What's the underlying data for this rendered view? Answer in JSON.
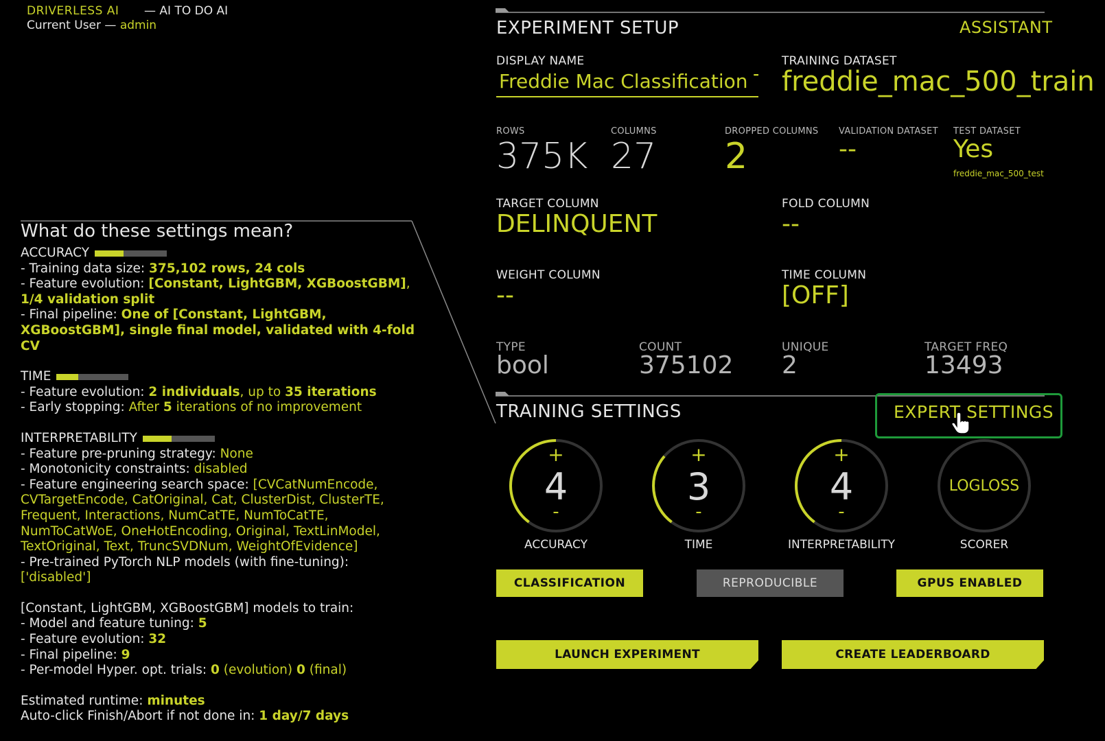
{
  "header": {
    "brand": "DRIVERLESS AI",
    "tagline": "— AI TO DO AI",
    "user_prefix": "Current User — ",
    "user_name": "admin"
  },
  "help": {
    "title": "What do these settings mean?",
    "accuracy": {
      "heading": "ACCURACY",
      "level": 0.4,
      "line1_prefix": "- Training data size: ",
      "line1_value": "375,102 rows, 24 cols",
      "line2_prefix": "- Feature evolution: ",
      "line2_value": "[Constant, LightGBM, XGBoostGBM]",
      "line2_sep": ", ",
      "line2_value2": "1/4 validation split",
      "line3_prefix": "- Final pipeline: ",
      "line3_value": "One of [Constant, LightGBM, XGBoostGBM], single final model, validated with 4-fold CV"
    },
    "time": {
      "heading": "TIME",
      "level": 0.3,
      "line1_prefix": "- Feature evolution: ",
      "line1_v1": "2 individuals",
      "line1_mid": ", up to ",
      "line1_v2": "35 iterations",
      "line2_prefix": "- Early stopping: ",
      "line2_a": "After ",
      "line2_b": "5",
      "line2_c": " iterations of no improvement"
    },
    "interpretability": {
      "heading": "INTERPRETABILITY",
      "level": 0.4,
      "line1_prefix": "- Feature pre-pruning strategy: ",
      "line1_value": "None",
      "line2_prefix": "- Monotonicity constraints: ",
      "line2_value": "disabled",
      "line3_prefix": "- Feature engineering search space: ",
      "line3_value": "[CVCatNumEncode, CVTargetEncode, CatOriginal, Cat, ClusterDist, ClusterTE, Frequent, Interactions, NumCatTE, NumToCatTE, NumToCatWoE, OneHotEncoding, Original, TextLinModel, TextOriginal, Text, TruncSVDNum, WeightOfEvidence]",
      "line4_prefix": "- Pre-trained PyTorch NLP models (with fine-tuning):",
      "line4_value": "['disabled']"
    },
    "models": {
      "heading": "[Constant, LightGBM, XGBoostGBM] models to train:",
      "l1_prefix": "- Model and feature tuning: ",
      "l1_value": "5",
      "l2_prefix": "- Feature evolution: ",
      "l2_value": "32",
      "l3_prefix": "- Final pipeline: ",
      "l3_value": "9",
      "l4_prefix": "- Per-model Hyper. opt. trials: ",
      "l4_v1": "0",
      "l4_t1": " (evolution) ",
      "l4_v2": "0",
      "l4_t2": " (final)"
    },
    "runtime": {
      "l1_prefix": "Estimated runtime: ",
      "l1_value": "minutes",
      "l2_prefix": "Auto-click Finish/Abort if not done in: ",
      "l2_value": "1 day/7 days"
    }
  },
  "setup": {
    "title": "EXPERIMENT SETUP",
    "assistant": "ASSISTANT",
    "display_name_label": "DISPLAY NAME",
    "display_name_value": "Freddie Mac Classification Tutorial",
    "training_dataset_label": "TRAINING DATASET",
    "training_dataset_value": "freddie_mac_500_train",
    "rows_label": "ROWS",
    "rows_value": "375K",
    "columns_label": "COLUMNS",
    "columns_value": "27",
    "dropped_label": "DROPPED COLUMNS",
    "dropped_value": "2",
    "validation_label": "VALIDATION DATASET",
    "validation_value": "--",
    "test_label": "TEST DATASET",
    "test_value": "Yes",
    "test_name": "freddie_mac_500_test",
    "target_label": "TARGET COLUMN",
    "target_value": "DELINQUENT",
    "fold_label": "FOLD COLUMN",
    "fold_value": "--",
    "weight_label": "WEIGHT COLUMN",
    "weight_value": "--",
    "time_label": "TIME COLUMN",
    "time_value": "[OFF]",
    "type_label": "TYPE",
    "type_value": "bool",
    "count_label": "COUNT",
    "count_value": "375102",
    "unique_label": "UNIQUE",
    "unique_value": "2",
    "freq_label": "TARGET FREQ",
    "freq_value": "13493"
  },
  "training": {
    "title": "TRAINING SETTINGS",
    "expert": "EXPERT SETTINGS",
    "dials": [
      {
        "label": "ACCURACY",
        "value": "4",
        "level": 0.4,
        "plus": "+",
        "minus": "-"
      },
      {
        "label": "TIME",
        "value": "3",
        "level": 0.3,
        "plus": "+",
        "minus": "-"
      },
      {
        "label": "INTERPRETABILITY",
        "value": "4",
        "level": 0.4,
        "plus": "+",
        "minus": "-"
      },
      {
        "label": "SCORER",
        "value": "LOGLOSS"
      }
    ],
    "toggles": {
      "classification": "CLASSIFICATION",
      "reproducible": "REPRODUCIBLE",
      "gpus": "GPUS ENABLED"
    },
    "launch": "LAUNCH EXPERIMENT",
    "leaderboard": "CREATE LEADERBOARD"
  },
  "colors": {
    "accent": "#c9d42a",
    "highlight_box": "#1e9a3a",
    "muted": "#555555"
  }
}
